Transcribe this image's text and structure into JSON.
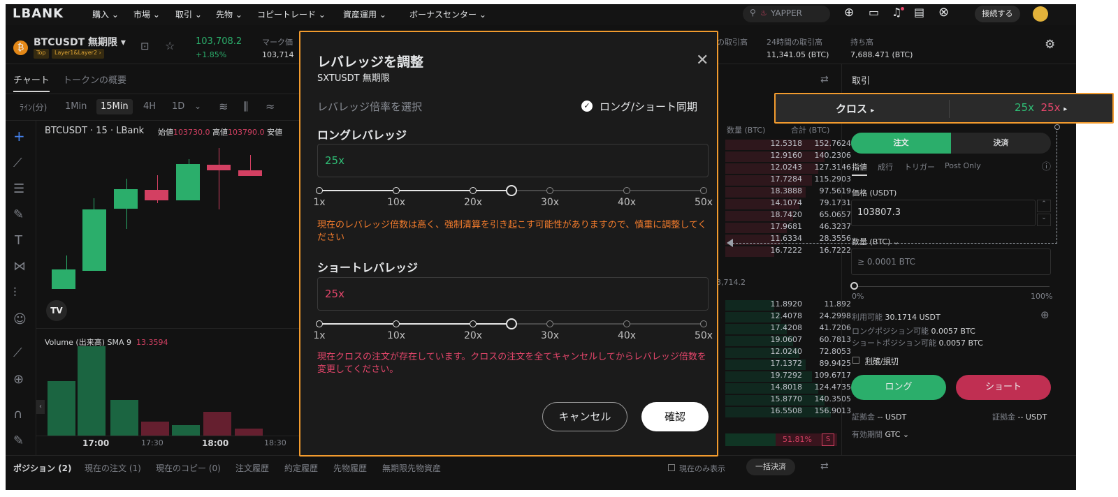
{
  "nav": {
    "logo": "LBANK",
    "items": [
      "購入",
      "市場",
      "取引",
      "先物",
      "コピートレード",
      "資産運用",
      "ボーナスセンター"
    ],
    "search": "YAPPER",
    "connect": "接続する"
  },
  "ticker": {
    "symbol": "BTCUSDT 無期限",
    "tag1": "Top",
    "tag2": "Layer1&Layer2",
    "price": "103,708.2",
    "change": "+1.85%",
    "mark_label": "マーク価",
    "mark_value": "103,714",
    "vol_label_partial": "の取引高",
    "vol_label": "24時間の取引高",
    "vol_value": "11,341.05 (BTC)",
    "oi_label": "持ち高",
    "oi_value": "7,688.471 (BTC)"
  },
  "chart": {
    "tabs": [
      "チャート",
      "トークンの概要"
    ],
    "timeframes": [
      "ﾗｲﾝ(分)",
      "1Min",
      "15Min",
      "4H",
      "1D"
    ],
    "title": "BTCUSDT · 15 · LBank",
    "open_label": "始値",
    "open_value": "103730.0",
    "high_label": "高値",
    "high_value": "103790.0",
    "low_label": "安値",
    "volume_label": "Volume (出来高) SMA 9",
    "volume_value": "13.3594",
    "x_labels": [
      "17:00",
      "17:30",
      "18:00",
      "18:30"
    ]
  },
  "orderbook": {
    "col_qty": "数量 (BTC)",
    "col_total": "合計 (BTC)",
    "mid": "03,714.2",
    "asks": [
      [
        "12.5318",
        "152.7624"
      ],
      [
        "12.9160",
        "140.2306"
      ],
      [
        "12.0243",
        "127.3146"
      ],
      [
        "17.7284",
        "115.2903"
      ],
      [
        "18.3888",
        "97.5619"
      ],
      [
        "14.1074",
        "79.1731"
      ],
      [
        "18.7420",
        "65.0657"
      ],
      [
        "17.9681",
        "46.3237"
      ],
      [
        "11.6334",
        "28.3556"
      ],
      [
        "16.7222",
        "16.7222"
      ]
    ],
    "bids": [
      [
        "11.8920",
        "11.892"
      ],
      [
        "12.4078",
        "24.2998"
      ],
      [
        "17.4208",
        "41.7206"
      ],
      [
        "19.0607",
        "60.7813"
      ],
      [
        "12.0240",
        "72.8053"
      ],
      [
        "17.1372",
        "89.9425"
      ],
      [
        "19.7292",
        "109.6717"
      ],
      [
        "14.8018",
        "124.4735"
      ],
      [
        "15.8770",
        "140.3505"
      ],
      [
        "16.5508",
        "156.9013"
      ]
    ],
    "ratio": "51.81%",
    "ratio_tag": "S"
  },
  "trade": {
    "title": "取引",
    "margin_mode": "クロス",
    "lev_long": "25x",
    "lev_short": "25x",
    "tab_order": "注文",
    "tab_close": "決済",
    "order_types": [
      "指値",
      "成行",
      "トリガー",
      "Post Only"
    ],
    "price_label": "価格 (USDT)",
    "price_value": "103807.3",
    "qty_label": "数量 (BTC)",
    "qty_placeholder": "≥ 0.0001 BTC",
    "pct_min": "0%",
    "pct_max": "100%",
    "avail_label": "利用可能",
    "avail_value": "30.1714 USDT",
    "long_avail": "ロングポジション可能",
    "long_avail_value": "0.0057 BTC",
    "short_avail": "ショートポジション可能",
    "short_avail_value": "0.0057 BTC",
    "tpsl": "利確/損切",
    "long_btn": "ロング",
    "short_btn": "ショート",
    "margin_label": "証拠金",
    "margin_value": "-- USDT",
    "tif_label": "有効期間",
    "tif_value": "GTC"
  },
  "bottom": {
    "tabs": [
      "ポジション (2)",
      "現在の注文 (1)",
      "現在のコピー (0)",
      "注文履歴",
      "約定履歴",
      "先物履歴",
      "無期限先物資産"
    ],
    "only_current": "現在のみ表示",
    "close_all": "一括決済"
  },
  "modal": {
    "title": "レバレッジを調整",
    "subtitle": "SXTUSDT 無期限",
    "select_label": "レバレッジ倍率を選択",
    "sync_label": "ロング/ショート同期",
    "long_label": "ロングレバレッジ",
    "long_value": "25x",
    "short_label": "ショートレバレッジ",
    "short_value": "25x",
    "ticks": [
      "1x",
      "10x",
      "20x",
      "30x",
      "40x",
      "50x"
    ],
    "long_level": 25,
    "short_level": 25,
    "warn_long": "現在のレバレッジ倍数は高く、強制清算を引き起こす可能性がありますので、慎重に調整してください",
    "warn_short": "現在クロスの注文が存在しています。クロスの注文を全てキャンセルしてからレバレッジ倍数を変更してください。",
    "cancel": "キャンセル",
    "confirm": "確認"
  },
  "colors": {
    "accent": "#f29b2e",
    "green": "#2fbd75",
    "red": "#e5466b"
  }
}
